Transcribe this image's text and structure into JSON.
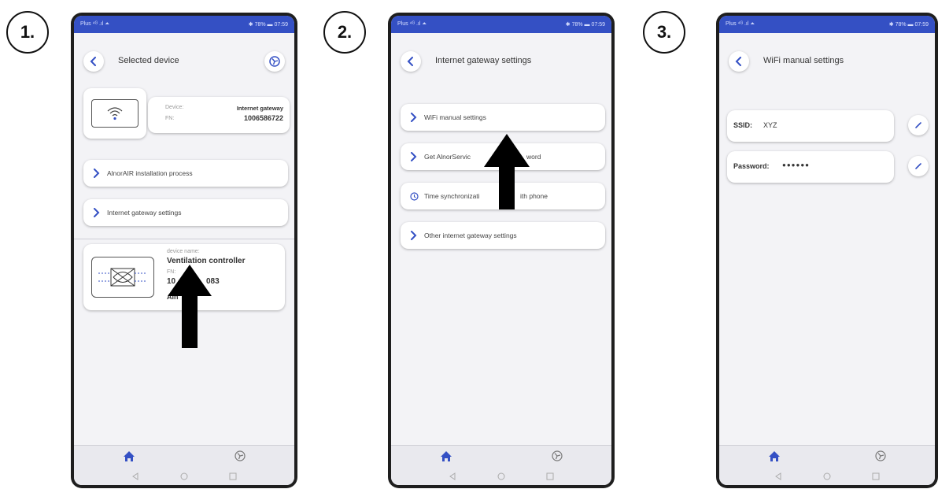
{
  "steps": [
    "1.",
    "2.",
    "3."
  ],
  "status_bar": {
    "left": "Plus ⁴ᴳ .ıl ⏶",
    "right": "✱ 78% ▬ 07:59"
  },
  "phone1": {
    "title": "Selected device",
    "gateway": {
      "device_label": "Device:",
      "device_value": "Internet gateway",
      "fn_label": "FN:",
      "fn_value": "1006586722"
    },
    "menu": [
      "AlnorAIR installation process",
      "Internet gateway settings"
    ],
    "controller": {
      "name_label": "device name:",
      "name_value": "Ventilation controller",
      "fn_label": "FN:",
      "fn_value_start": "10",
      "fn_value_end": "083",
      "brand": "Aln"
    }
  },
  "phone2": {
    "title": "Internet gateway settings",
    "menu": [
      "WiFi manual settings",
      "Get AlnorServic",
      "word",
      "Time synchronizati",
      "ith phone",
      "Other internet gateway settings"
    ]
  },
  "phone3": {
    "title": "WiFi manual settings",
    "ssid_label": "SSID:",
    "ssid_value": "XYZ",
    "password_label": "Password:",
    "password_value": "●●●●●●"
  },
  "colors": {
    "accent": "#3450c4",
    "background": "#f3f3f6"
  },
  "icons": [
    "chevron-left-icon",
    "fan-icon",
    "wifi-icon",
    "chevron-right-icon",
    "clock-icon",
    "pencil-icon",
    "home-icon"
  ]
}
